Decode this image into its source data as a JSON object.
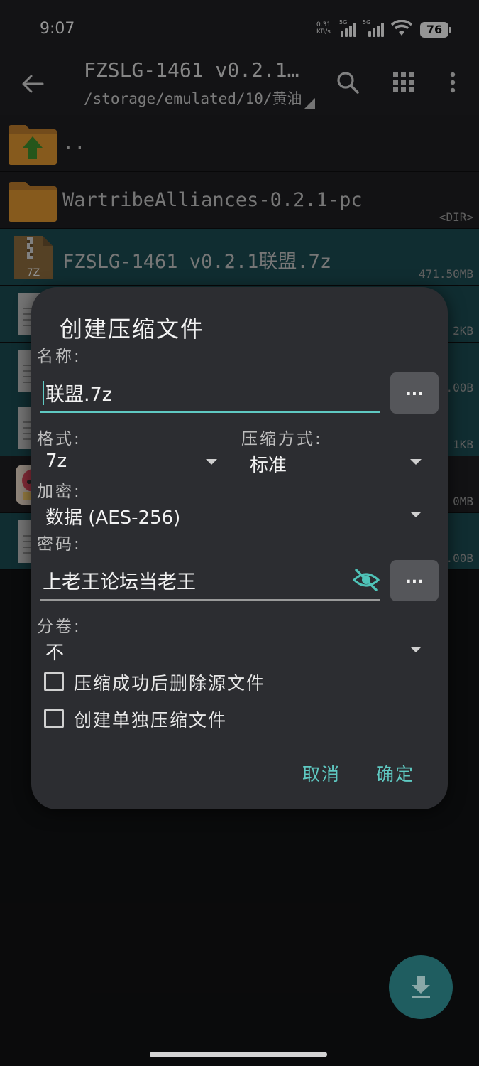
{
  "status_bar": {
    "time": "9:07",
    "net_speed_value": "0.31",
    "net_speed_unit": "KB/s",
    "signal_tag_1": "5G",
    "signal_tag_2": "5G",
    "battery": "76"
  },
  "app_bar": {
    "title": "FZSLG-1461 v0.2.1…",
    "path": "/storage/emulated/10/黄油",
    "icons": [
      "back-arrow",
      "search",
      "grid-view",
      "more-vertical"
    ]
  },
  "files": [
    {
      "name": "..",
      "meta": "",
      "icon": "folder-up",
      "selected": false
    },
    {
      "name": "WartribeAlliances-0.2.1-pc",
      "meta": "<DIR>",
      "icon": "folder",
      "selected": false
    },
    {
      "name": "FZSLG-1461 v0.2.1联盟.7z",
      "meta": "471.50MB",
      "icon": "archive-7z",
      "selected": true
    },
    {
      "name": "",
      "meta": "2KB",
      "icon": "document",
      "selected": true
    },
    {
      "name": "",
      "meta": ".00B",
      "icon": "document",
      "selected": true
    },
    {
      "name": "",
      "meta": "1KB",
      "icon": "document",
      "selected": true
    },
    {
      "name": "",
      "meta": "0MB",
      "icon": "app-image",
      "selected": false
    },
    {
      "name": "",
      "meta": ".00B",
      "icon": "document",
      "selected": true
    }
  ],
  "dialog": {
    "title": "创建压缩文件",
    "name_label": "名称:",
    "name_value": "联盟.7z",
    "dots": "...",
    "format_label": "格式:",
    "format_value": "7z",
    "method_label": "压缩方式:",
    "method_value": "标准",
    "encrypt_label": "加密:",
    "encrypt_value": "数据 (AES-256)",
    "password_label": "密码:",
    "password_value": "上老王论坛当老王",
    "split_label": "分卷:",
    "split_value": "不",
    "delete_source_label": "压缩成功后删除源文件",
    "delete_source_checked": false,
    "separate_label": "创建单独压缩文件",
    "separate_checked": false,
    "cancel": "取消",
    "ok": "确定"
  },
  "colors": {
    "accent": "#5fc9c2",
    "dialog_bg": "#2c2d31",
    "selected_row": "#1b4a4f",
    "fab": "#1f5d60"
  }
}
